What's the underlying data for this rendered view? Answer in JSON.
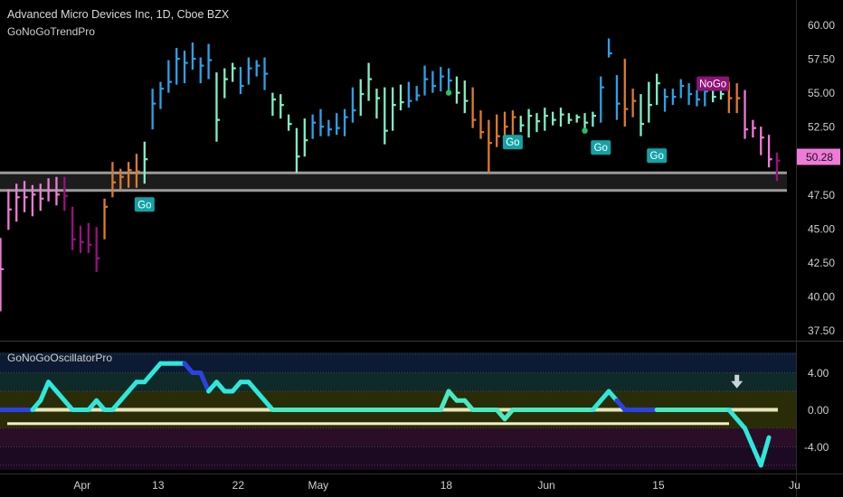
{
  "header": {
    "title": "Advanced Micro Devices Inc, 1D, Cboe BZX",
    "subtitle": "GoNoGoTrendPro",
    "oscillator_title": "GoNoGoOscillatorPro"
  },
  "price_badge": "50.28",
  "colors": {
    "strong_go": "#29a3e8",
    "go": "#7ef0c6",
    "go_fading": "#e07a2a",
    "nogo": "#f07ad8",
    "strong_nogo": "#9c0f82",
    "badge_go": "#13a3a6",
    "badge_nogo": "#8e1377",
    "osc_line_cyan": "#2ee8dc",
    "osc_line_blue": "#2b42e0",
    "osc_line_light": "#48ebc0",
    "price_badge_bg": "#f07ad8"
  },
  "chart_data": {
    "type": "bar",
    "price_panel": {
      "y_ticks": [
        "60.00",
        "57.50",
        "55.00",
        "52.50",
        "50.28",
        "47.50",
        "45.00",
        "42.50",
        "40.00",
        "37.50"
      ],
      "ylim": [
        36.8,
        61.3
      ],
      "support_zone": [
        47.8,
        49.1
      ],
      "x_labels": [
        "Apr",
        "13",
        "22",
        "May",
        "18",
        "Jun",
        "15",
        "Ju"
      ],
      "bars": [
        {
          "h": 44.3,
          "l": 38.9,
          "c": 42.0,
          "t": "nogo"
        },
        {
          "h": 47.9,
          "l": 44.9,
          "c": 46.4,
          "t": "nogo"
        },
        {
          "h": 48.3,
          "l": 45.5,
          "c": 47.3,
          "t": "nogo"
        },
        {
          "h": 48.5,
          "l": 46.2,
          "c": 47.3,
          "t": "nogo"
        },
        {
          "h": 48.2,
          "l": 45.9,
          "c": 47.5,
          "t": "nogo"
        },
        {
          "h": 48.3,
          "l": 46.3,
          "c": 47.2,
          "t": "nogo"
        },
        {
          "h": 48.7,
          "l": 47.0,
          "c": 47.8,
          "t": "nogo"
        },
        {
          "h": 48.8,
          "l": 46.7,
          "c": 47.5,
          "t": "nogo"
        },
        {
          "h": 48.8,
          "l": 46.3,
          "c": 47.4,
          "t": "strong_nogo"
        },
        {
          "h": 46.6,
          "l": 43.4,
          "c": 44.2,
          "t": "strong_nogo"
        },
        {
          "h": 45.2,
          "l": 43.2,
          "c": 44.0,
          "t": "strong_nogo"
        },
        {
          "h": 45.4,
          "l": 43.2,
          "c": 43.8,
          "t": "strong_nogo"
        },
        {
          "h": 45.1,
          "l": 41.8,
          "c": 42.8,
          "t": "strong_nogo"
        },
        {
          "h": 47.2,
          "l": 44.2,
          "c": 46.6,
          "t": "go_fading"
        },
        {
          "h": 49.9,
          "l": 47.3,
          "c": 48.4,
          "t": "go_fading"
        },
        {
          "h": 49.4,
          "l": 47.9,
          "c": 48.8,
          "t": "go_fading"
        },
        {
          "h": 49.9,
          "l": 48.0,
          "c": 49.3,
          "t": "go_fading"
        },
        {
          "h": 50.5,
          "l": 48.0,
          "c": 49.2,
          "t": "go_fading"
        },
        {
          "h": 51.4,
          "l": 48.3,
          "c": 50.1,
          "t": "go"
        },
        {
          "h": 55.3,
          "l": 52.3,
          "c": 54.2,
          "t": "strong_go"
        },
        {
          "h": 55.8,
          "l": 53.8,
          "c": 55.3,
          "t": "strong_go"
        },
        {
          "h": 57.4,
          "l": 55.0,
          "c": 55.8,
          "t": "strong_go"
        },
        {
          "h": 58.3,
          "l": 55.6,
          "c": 57.5,
          "t": "strong_go"
        },
        {
          "h": 58.1,
          "l": 55.7,
          "c": 57.2,
          "t": "strong_go"
        },
        {
          "h": 58.7,
          "l": 56.7,
          "c": 57.5,
          "t": "strong_go"
        },
        {
          "h": 57.6,
          "l": 55.7,
          "c": 57.0,
          "t": "strong_go"
        },
        {
          "h": 58.6,
          "l": 56.0,
          "c": 57.4,
          "t": "strong_go"
        },
        {
          "h": 56.5,
          "l": 51.4,
          "c": 53.0,
          "t": "go"
        },
        {
          "h": 56.8,
          "l": 54.6,
          "c": 56.0,
          "t": "go"
        },
        {
          "h": 57.2,
          "l": 55.8,
          "c": 56.8,
          "t": "go"
        },
        {
          "h": 56.9,
          "l": 54.9,
          "c": 55.5,
          "t": "strong_go"
        },
        {
          "h": 57.6,
          "l": 55.6,
          "c": 56.8,
          "t": "strong_go"
        },
        {
          "h": 57.4,
          "l": 56.2,
          "c": 57.0,
          "t": "strong_go"
        },
        {
          "h": 57.6,
          "l": 55.2,
          "c": 56.4,
          "t": "strong_go"
        },
        {
          "h": 55.0,
          "l": 53.3,
          "c": 54.5,
          "t": "go"
        },
        {
          "h": 54.9,
          "l": 53.1,
          "c": 54.1,
          "t": "go"
        },
        {
          "h": 53.4,
          "l": 52.2,
          "c": 52.7,
          "t": "go"
        },
        {
          "h": 52.4,
          "l": 49.1,
          "c": 50.3,
          "t": "go"
        },
        {
          "h": 53.1,
          "l": 50.3,
          "c": 51.5,
          "t": "go"
        },
        {
          "h": 53.4,
          "l": 51.6,
          "c": 52.8,
          "t": "strong_go"
        },
        {
          "h": 53.8,
          "l": 51.8,
          "c": 52.5,
          "t": "strong_go"
        },
        {
          "h": 53.0,
          "l": 51.8,
          "c": 52.3,
          "t": "strong_go"
        },
        {
          "h": 53.5,
          "l": 51.9,
          "c": 52.4,
          "t": "strong_go"
        },
        {
          "h": 53.8,
          "l": 51.8,
          "c": 53.2,
          "t": "strong_go"
        },
        {
          "h": 55.4,
          "l": 52.8,
          "c": 53.7,
          "t": "strong_go"
        },
        {
          "h": 56.0,
          "l": 53.3,
          "c": 54.9,
          "t": "go"
        },
        {
          "h": 57.2,
          "l": 54.4,
          "c": 56.0,
          "t": "go"
        },
        {
          "h": 55.3,
          "l": 53.1,
          "c": 54.6,
          "t": "go"
        },
        {
          "h": 55.4,
          "l": 51.2,
          "c": 52.2,
          "t": "go"
        },
        {
          "h": 55.4,
          "l": 52.2,
          "c": 54.1,
          "t": "go"
        },
        {
          "h": 55.6,
          "l": 53.7,
          "c": 54.3,
          "t": "go"
        },
        {
          "h": 55.8,
          "l": 53.9,
          "c": 54.4,
          "t": "strong_go"
        },
        {
          "h": 55.5,
          "l": 54.4,
          "c": 54.8,
          "t": "strong_go"
        },
        {
          "h": 57.0,
          "l": 54.8,
          "c": 56.0,
          "t": "strong_go"
        },
        {
          "h": 56.6,
          "l": 55.0,
          "c": 55.5,
          "t": "strong_go"
        },
        {
          "h": 56.9,
          "l": 55.1,
          "c": 56.2,
          "t": "strong_go"
        },
        {
          "h": 56.8,
          "l": 55.2,
          "c": 55.9,
          "t": "strong_go"
        },
        {
          "h": 56.2,
          "l": 54.2,
          "c": 55.0,
          "t": "go"
        },
        {
          "h": 55.9,
          "l": 53.5,
          "c": 54.4,
          "t": "go"
        },
        {
          "h": 55.4,
          "l": 52.4,
          "c": 53.0,
          "t": "go_fading"
        },
        {
          "h": 53.7,
          "l": 51.6,
          "c": 52.1,
          "t": "go_fading"
        },
        {
          "h": 53.0,
          "l": 49.1,
          "c": 51.3,
          "t": "go_fading"
        },
        {
          "h": 53.4,
          "l": 51.0,
          "c": 51.8,
          "t": "go_fading"
        },
        {
          "h": 53.6,
          "l": 51.3,
          "c": 52.5,
          "t": "go_fading"
        },
        {
          "h": 53.7,
          "l": 51.9,
          "c": 53.2,
          "t": "go_fading"
        },
        {
          "h": 53.3,
          "l": 52.1,
          "c": 52.6,
          "t": "go"
        },
        {
          "h": 53.8,
          "l": 51.7,
          "c": 53.3,
          "t": "go"
        },
        {
          "h": 53.5,
          "l": 52.1,
          "c": 52.9,
          "t": "go"
        },
        {
          "h": 53.9,
          "l": 52.2,
          "c": 53.3,
          "t": "go"
        },
        {
          "h": 53.6,
          "l": 52.6,
          "c": 53.0,
          "t": "go"
        },
        {
          "h": 53.9,
          "l": 52.5,
          "c": 53.4,
          "t": "go"
        },
        {
          "h": 53.5,
          "l": 52.7,
          "c": 53.0,
          "t": "go"
        },
        {
          "h": 53.4,
          "l": 52.8,
          "c": 53.2,
          "t": "go"
        },
        {
          "h": 53.5,
          "l": 52.3,
          "c": 52.8,
          "t": "go"
        },
        {
          "h": 53.6,
          "l": 52.5,
          "c": 53.3,
          "t": "go"
        },
        {
          "h": 56.2,
          "l": 52.8,
          "c": 55.4,
          "t": "strong_go"
        },
        {
          "h": 59.0,
          "l": 57.6,
          "c": 57.9,
          "t": "strong_go"
        },
        {
          "h": 56.3,
          "l": 53.0,
          "c": 54.2,
          "t": "strong_go"
        },
        {
          "h": 57.5,
          "l": 52.5,
          "c": 53.8,
          "t": "go_fading"
        },
        {
          "h": 55.3,
          "l": 53.2,
          "c": 54.4,
          "t": "go_fading"
        },
        {
          "h": 54.9,
          "l": 51.8,
          "c": 52.7,
          "t": "go"
        },
        {
          "h": 55.8,
          "l": 52.8,
          "c": 54.1,
          "t": "go"
        },
        {
          "h": 56.4,
          "l": 54.1,
          "c": 55.7,
          "t": "go"
        },
        {
          "h": 55.3,
          "l": 53.6,
          "c": 54.7,
          "t": "strong_go"
        },
        {
          "h": 55.3,
          "l": 54.1,
          "c": 54.7,
          "t": "strong_go"
        },
        {
          "h": 56.0,
          "l": 54.6,
          "c": 55.5,
          "t": "strong_go"
        },
        {
          "h": 55.7,
          "l": 54.1,
          "c": 54.9,
          "t": "strong_go"
        },
        {
          "h": 55.2,
          "l": 54.0,
          "c": 54.5,
          "t": "strong_go"
        },
        {
          "h": 55.6,
          "l": 54.0,
          "c": 55.1,
          "t": "strong_go"
        },
        {
          "h": 55.3,
          "l": 54.3,
          "c": 54.7,
          "t": "go"
        },
        {
          "h": 55.4,
          "l": 54.5,
          "c": 54.9,
          "t": "go"
        },
        {
          "h": 55.8,
          "l": 53.5,
          "c": 54.6,
          "t": "go_fading"
        },
        {
          "h": 55.7,
          "l": 53.5,
          "c": 54.6,
          "t": "go_fading"
        },
        {
          "h": 55.2,
          "l": 51.6,
          "c": 52.3,
          "t": "nogo"
        },
        {
          "h": 53.0,
          "l": 51.7,
          "c": 52.4,
          "t": "nogo"
        },
        {
          "h": 52.5,
          "l": 50.4,
          "c": 51.7,
          "t": "nogo"
        },
        {
          "h": 51.9,
          "l": 49.5,
          "c": 50.1,
          "t": "nogo"
        },
        {
          "h": 50.6,
          "l": 48.5,
          "c": 50.0,
          "t": "strong_nogo"
        }
      ],
      "annotations": [
        {
          "label": "Go",
          "bar": 18,
          "price": 47.3,
          "kind": "go"
        },
        {
          "label": "Go",
          "bar": 64,
          "price": 51.9,
          "kind": "go"
        },
        {
          "label": "Go",
          "bar": 75,
          "price": 51.5,
          "kind": "go"
        },
        {
          "label": "Go",
          "bar": 82,
          "price": 50.9,
          "kind": "go"
        },
        {
          "label": "NoGo",
          "bar": 89,
          "price": 56.2,
          "kind": "nogo"
        }
      ],
      "dots": [
        {
          "bar": 56,
          "price": 55.0,
          "kind": "go"
        },
        {
          "bar": 73,
          "price": 52.2,
          "kind": "go"
        },
        {
          "bar": 89,
          "price": 55.4,
          "kind": "nogo"
        }
      ]
    },
    "oscillator_panel": {
      "y_ticks": [
        "4.00",
        "0.00",
        "-4.00"
      ],
      "ylim": [
        -6.5,
        6.2
      ],
      "zero_band": [
        -0.2,
        0.2
      ],
      "values": [
        0,
        0,
        0,
        0,
        0,
        1,
        3,
        2,
        1,
        0,
        0,
        0,
        1,
        0,
        0,
        1,
        2,
        3,
        3,
        4,
        5,
        5,
        5,
        5,
        4,
        4,
        2,
        3,
        2,
        2,
        3,
        3,
        2,
        1,
        0,
        0,
        0,
        0,
        0,
        0,
        0,
        0,
        0,
        0,
        0,
        0,
        0,
        0,
        0,
        0,
        0,
        0,
        0,
        0,
        0,
        0,
        2,
        1,
        1,
        0,
        0,
        0,
        0,
        -1,
        0,
        0,
        0,
        0,
        0,
        0,
        0,
        0,
        0,
        0,
        0,
        1,
        2,
        1,
        0,
        0,
        0,
        0,
        0,
        0,
        0,
        0,
        0,
        0,
        0,
        0,
        0,
        0,
        -1,
        -2,
        -4,
        -6,
        -3
      ],
      "colors": [
        "blue",
        "blue",
        "blue",
        "blue",
        "cyan",
        "cyan",
        "cyan",
        "cyan",
        "cyan",
        "cyan",
        "cyan",
        "cyan",
        "cyan",
        "cyan",
        "cyan",
        "cyan",
        "cyan",
        "cyan",
        "cyan",
        "cyan",
        "cyan",
        "cyan",
        "cyan",
        "blue",
        "blue",
        "blue",
        "cyan",
        "cyan",
        "cyan",
        "cyan",
        "cyan",
        "cyan",
        "cyan",
        "cyan",
        "light",
        "light",
        "light",
        "light",
        "light",
        "light",
        "light",
        "light",
        "light",
        "light",
        "light",
        "light",
        "light",
        "light",
        "light",
        "light",
        "light",
        "light",
        "light",
        "light",
        "light",
        "light",
        "light",
        "light",
        "light",
        "light",
        "light",
        "light",
        "light",
        "light",
        "light",
        "light",
        "light",
        "light",
        "light",
        "light",
        "light",
        "light",
        "light",
        "light",
        "cyan",
        "cyan",
        "cyan",
        "blue",
        "blue",
        "blue",
        "blue",
        "blue",
        "light",
        "light",
        "light",
        "light",
        "light",
        "light",
        "light",
        "light",
        "light",
        "cyan",
        "cyan",
        "cyan",
        "cyan",
        "cyan"
      ]
    }
  }
}
